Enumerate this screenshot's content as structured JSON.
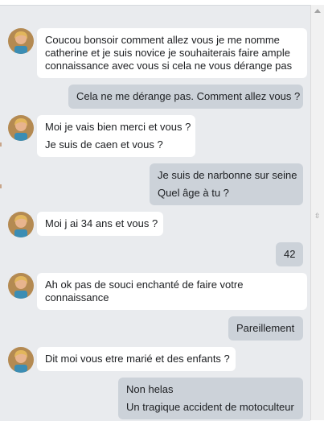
{
  "colors": {
    "pane_background": "#e9ebee",
    "incoming_bubble": "#ffffff",
    "outgoing_bubble": "#ccd2d9",
    "text": "#1c1e21"
  },
  "messages": [
    {
      "from": "them",
      "lines": [
        "Coucou bonsoir comment allez vous je me nomme",
        "catherine et je suis novice je souhaiterais faire ample",
        "connaissance avec vous si cela ne vous dérange pas"
      ]
    },
    {
      "from": "me",
      "lines": [
        "Cela ne me dérange pas. Comment allez vous ?"
      ]
    },
    {
      "from": "them",
      "lines": [
        "Moi je vais bien merci et vous ?",
        "Je suis de caen et vous ?"
      ]
    },
    {
      "from": "me",
      "lines": [
        "Je suis de narbonne sur seine",
        "Quel âge à tu ?"
      ]
    },
    {
      "from": "them",
      "lines": [
        "Moi j ai 34 ans et vous ?"
      ]
    },
    {
      "from": "me",
      "lines": [
        "42"
      ]
    },
    {
      "from": "them",
      "lines": [
        "Ah ok pas de souci enchanté de faire votre",
        "connaissance"
      ]
    },
    {
      "from": "me",
      "lines": [
        "Pareillement"
      ]
    },
    {
      "from": "them",
      "lines": [
        "Dit moi vous etre marié et des enfants ?"
      ]
    },
    {
      "from": "me",
      "lines": [
        "Non helas",
        "Un tragique accident de motoculteur"
      ]
    }
  ],
  "scrollbar": {
    "up_icon": "triangle-up-icon",
    "grip_icon": "grip-icon"
  }
}
